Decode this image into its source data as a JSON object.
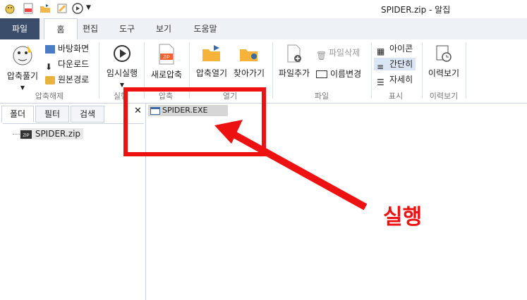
{
  "window": {
    "title": "SPIDER.zip - 알집"
  },
  "quick_access": [
    "app-logo-icon",
    "zip-file-icon",
    "open-folder-icon",
    "settings-icon",
    "play-icon",
    "dropdown-arrow-icon"
  ],
  "tabs": [
    {
      "label": "파일"
    },
    {
      "label": "홈"
    },
    {
      "label": "편집"
    },
    {
      "label": "도구"
    },
    {
      "label": "보기"
    },
    {
      "label": "도움말"
    }
  ],
  "ribbon": {
    "extract": {
      "main_label": "압축풀기",
      "desktop": "바탕화면",
      "downloads": "다운로드",
      "original_path": "원본경로",
      "group": "압축해제"
    },
    "run": {
      "label": "임시실행",
      "group": "실행"
    },
    "compress": {
      "label": "새로압축",
      "group": "압축"
    },
    "open": {
      "open_label": "압축열기",
      "find_label": "찾아가기",
      "group": "열기"
    },
    "file": {
      "add_label": "파일추가",
      "delete_label": "파일삭제",
      "rename_label": "이름변경",
      "group": "파일"
    },
    "view": {
      "icons": "아이콘",
      "simple": "간단히",
      "details": "자세히",
      "group": "표시"
    },
    "history": {
      "label": "이력보기",
      "group": "이력보기"
    }
  },
  "left_panel": {
    "tabs": [
      "폴더",
      "필터",
      "검색"
    ],
    "tree_item": "SPIDER.zip"
  },
  "file_list": [
    {
      "name": "SPIDER.EXE"
    }
  ],
  "annotation": {
    "text": "실행",
    "color": "#ee1111"
  },
  "colors": {
    "file_tab": "#3a4d6b",
    "highlight": "#dbe6f5"
  }
}
